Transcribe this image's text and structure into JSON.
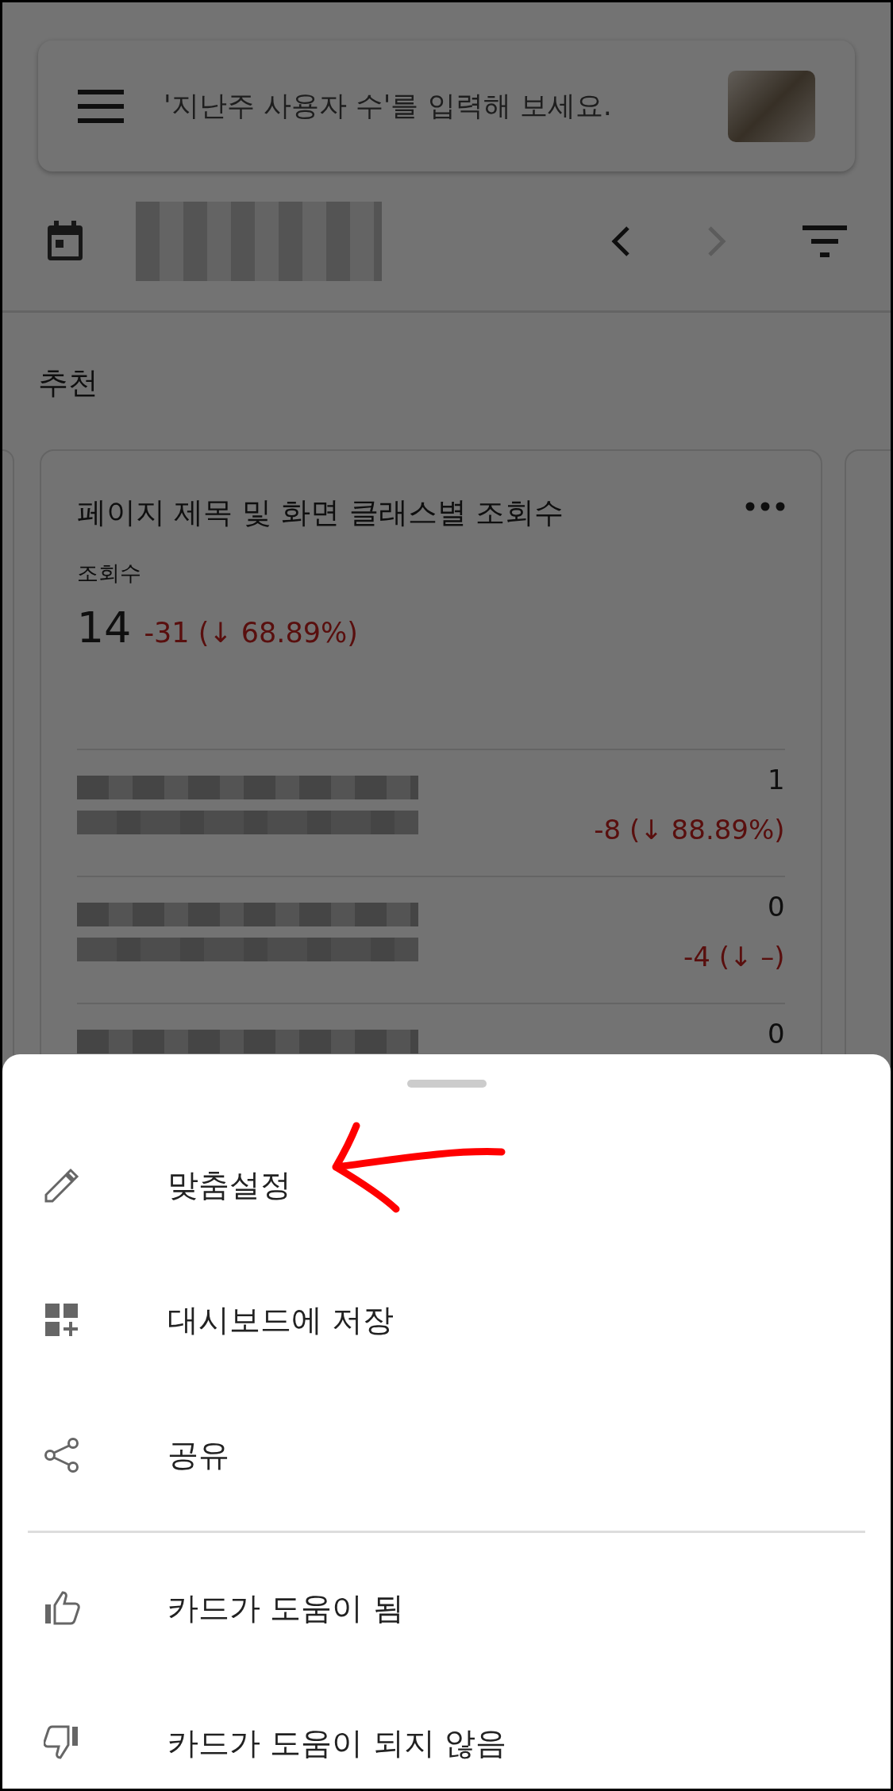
{
  "search": {
    "placeholder": "'지난주 사용자 수'를 입력해 보세요."
  },
  "section_title": "추천",
  "card": {
    "title": "페이지 제목 및 화면 클래스별 조회수",
    "metric_label": "조회수",
    "value": "14",
    "change": "-31 (↓ 68.89%)",
    "rows": [
      {
        "value": "1",
        "change": "-8 (↓ 88.89%)"
      },
      {
        "value": "0",
        "change": "-4 (↓ –)"
      },
      {
        "value": "0"
      }
    ]
  },
  "menu": [
    {
      "kind": "pencil",
      "label": "맞춤설정",
      "divider_before": false
    },
    {
      "kind": "dashboard",
      "label": "대시보드에 저장",
      "divider_before": false
    },
    {
      "kind": "share",
      "label": "공유",
      "divider_before": false
    },
    {
      "kind": "like",
      "label": "카드가 도움이 됨",
      "divider_before": true
    },
    {
      "kind": "dislike",
      "label": "카드가 도움이 되지 않음",
      "divider_before": false
    }
  ]
}
